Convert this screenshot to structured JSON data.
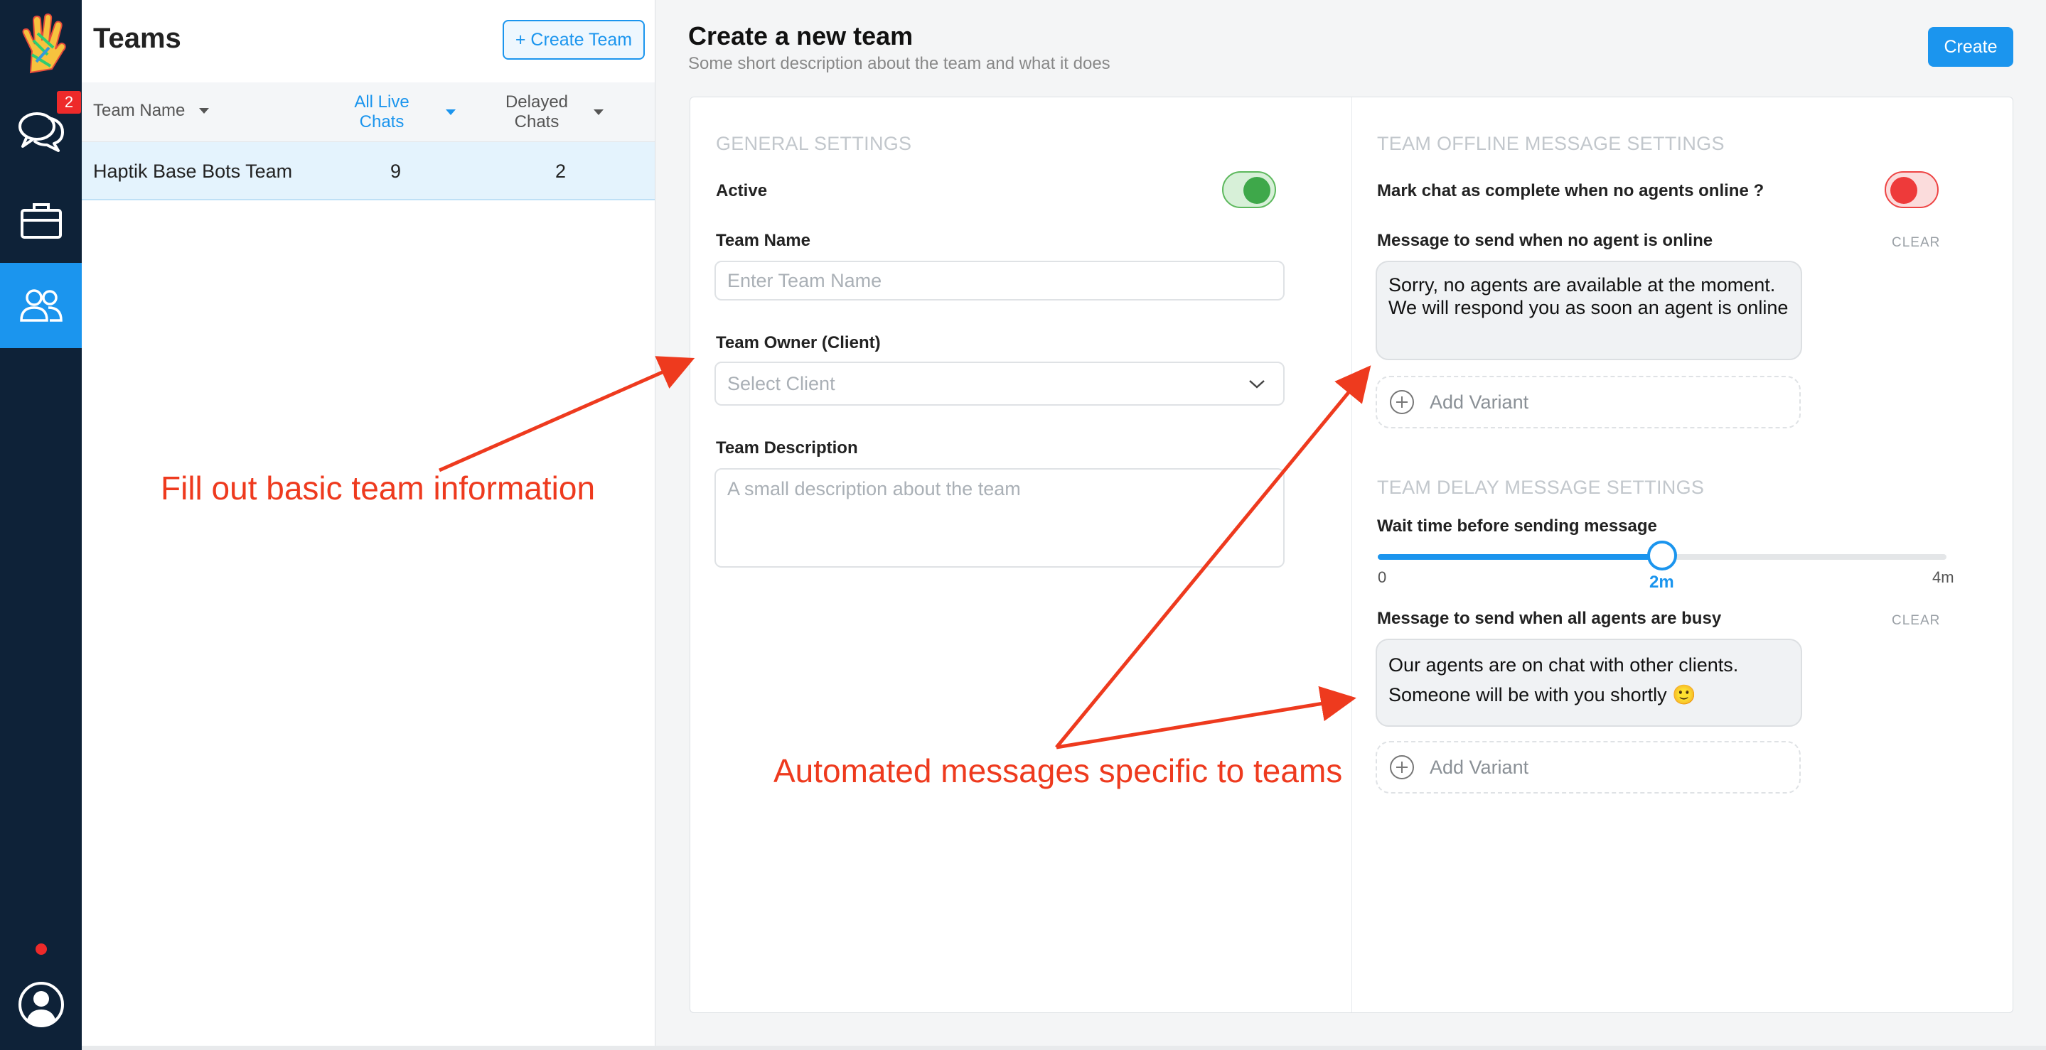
{
  "sidebar": {
    "unread_count": "2",
    "items": [
      {
        "name": "chats",
        "icon": "chat-bubbles-icon"
      },
      {
        "name": "briefcase",
        "icon": "briefcase-icon"
      },
      {
        "name": "teams",
        "icon": "users-icon",
        "active": true
      }
    ]
  },
  "teams_panel": {
    "title": "Teams",
    "create_label": "+ Create Team",
    "columns": {
      "name": "Team Name",
      "live": "All Live Chats",
      "delayed": "Delayed Chats"
    },
    "rows": [
      {
        "name": "Haptik Base Bots Team",
        "live": "9",
        "delayed": "2"
      }
    ]
  },
  "main": {
    "title": "Create a new team",
    "subtitle": "Some short description about the team and what it does",
    "create_label": "Create"
  },
  "general": {
    "section_title": "GENERAL SETTINGS",
    "active_label": "Active",
    "active": true,
    "team_name_label": "Team Name",
    "team_name_placeholder": "Enter Team Name",
    "owner_label": "Team Owner (Client)",
    "owner_placeholder": "Select Client",
    "description_label": "Team Description",
    "description_placeholder": "A small description about the team"
  },
  "offline": {
    "section_title": "TEAM OFFLINE MESSAGE SETTINGS",
    "mark_complete_label": "Mark chat as complete when no agents online ?",
    "mark_complete": false,
    "message_label": "Message to send when no agent is online",
    "clear_label": "CLEAR",
    "message_text": "Sorry, no agents are available at the moment. We will respond you as soon an agent is online",
    "add_variant_label": "Add Variant"
  },
  "delay": {
    "section_title": "TEAM DELAY MESSAGE SETTINGS",
    "wait_label": "Wait time before sending message",
    "slider_min": "0",
    "slider_max": "4m",
    "slider_value_label": "2m",
    "slider_fraction": 0.5,
    "message_label": "Message to send when all agents are busy",
    "clear_label": "CLEAR",
    "message_text": "Our agents are on chat with other clients. Someone will be with you shortly 🙂",
    "add_variant_label": "Add Variant"
  },
  "annotations": {
    "left_note": "Fill out basic team information",
    "right_note": "Automated messages specific to teams",
    "color": "#ee3a1e"
  },
  "colors": {
    "brand": "#1b95ee",
    "rail": "#0e2238",
    "active_toggle": "#3ea84a",
    "off_toggle": "#ee3a3a"
  }
}
